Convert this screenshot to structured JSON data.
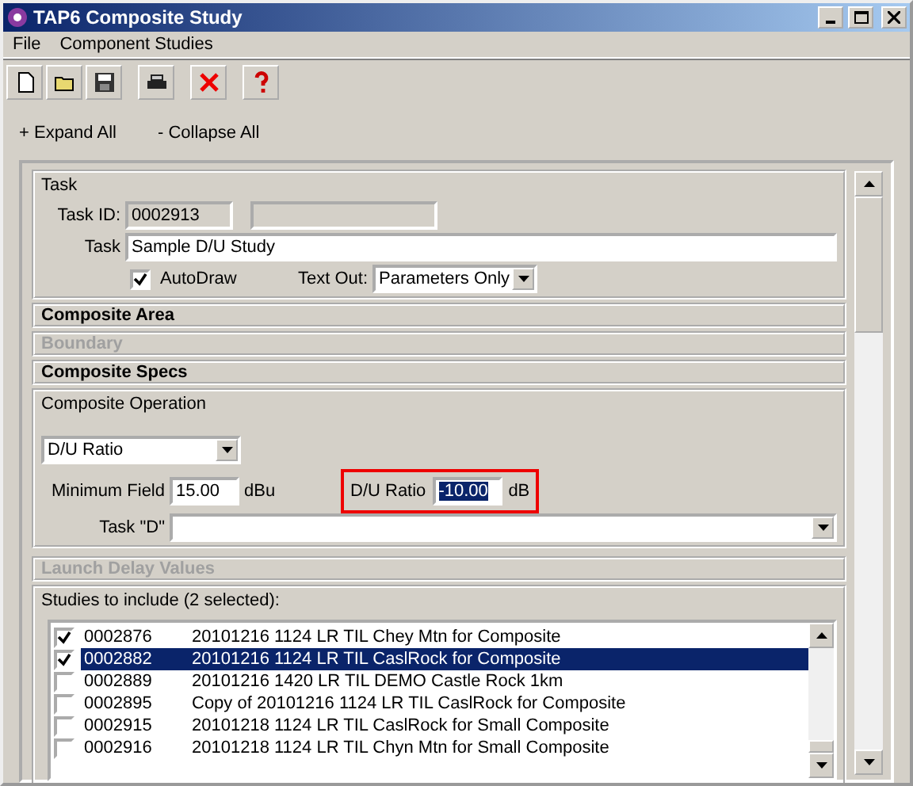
{
  "window": {
    "title": "TAP6 Composite Study"
  },
  "menu": [
    "File",
    "Component Studies"
  ],
  "toolbar": [
    {
      "kind": "new"
    },
    {
      "kind": "open"
    },
    {
      "kind": "save"
    },
    {
      "kind": "print"
    },
    {
      "kind": "delete"
    },
    {
      "kind": "help"
    }
  ],
  "expand": {
    "expand_all": "+ Expand All",
    "collapse_all": "- Collapse All"
  },
  "task": {
    "title": "Task",
    "task_id_label": "Task ID:",
    "task_id": "0002913",
    "task_label": "Task",
    "task_value": "Sample D/U Study",
    "autodraw_label": "AutoDraw",
    "autodraw_checked": true,
    "text_out_label": "Text Out:",
    "text_out_value": "Parameters Only"
  },
  "sections": [
    {
      "label": "Composite Area",
      "disabled": false
    },
    {
      "label": "Boundary",
      "disabled": true
    },
    {
      "label": "Composite Specs",
      "disabled": false
    }
  ],
  "composite_operation": {
    "title": "Composite Operation",
    "operation": "D/U Ratio",
    "min_field_label": "Minimum Field",
    "min_field_value": "15.00",
    "min_field_unit": "dBu",
    "du_label": "D/U Ratio",
    "du_value": "-10.00",
    "du_unit": "dB",
    "task_d_label": "Task \"D\""
  },
  "launch_delay": {
    "label": "Launch Delay Values",
    "disabled": true
  },
  "studies": {
    "title": "Studies to include (2 selected):",
    "rows": [
      {
        "id": "0002876",
        "name": "20101216 1124 LR TIL Chey Mtn for Composite",
        "checked": true,
        "selected": false
      },
      {
        "id": "0002882",
        "name": "20101216 1124 LR TIL CaslRock for Composite",
        "checked": true,
        "selected": true
      },
      {
        "id": "0002889",
        "name": "20101216 1420 LR TIL DEMO Castle Rock 1km",
        "checked": false,
        "selected": false
      },
      {
        "id": "0002895",
        "name": "Copy of 20101216 1124 LR TIL CaslRock for Composite",
        "checked": false,
        "selected": false
      },
      {
        "id": "0002915",
        "name": "20101218 1124 LR TIL CaslRock for Small Composite",
        "checked": false,
        "selected": false
      },
      {
        "id": "0002916",
        "name": "20101218 1124 LR TIL Chyn Mtn for Small Composite",
        "checked": false,
        "selected": false
      }
    ]
  }
}
